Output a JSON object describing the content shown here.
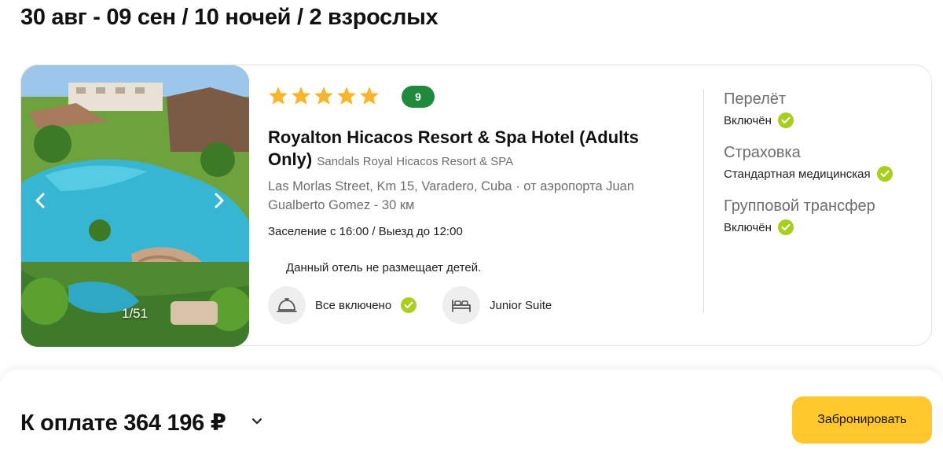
{
  "trip": {
    "summary": "30 авг - 09 сен / 10 ночей / 2 взрослых"
  },
  "hotel": {
    "stars": 5,
    "rating": "9",
    "name": "Royalton Hicacos Resort & Spa Hotel (Adults Only)",
    "alt_name": "Sandals Royal Hicacos Resort & SPA",
    "address": "Las Morlas Street, Km 15, Varadero, Cuba",
    "airport_distance": "от аэропорта Juan Gualberto Gomez - 30 км",
    "checkin_checkout": "Заселение с 16:00 / Выезд до 12:00",
    "children_note": "Данный отель не размещает детей.",
    "meal_plan": "Все включено",
    "room_type": "Junior Suite",
    "photo_counter": "1/51"
  },
  "services": [
    {
      "title": "Перелёт",
      "value": "Включён"
    },
    {
      "title": "Страховка",
      "value": "Стандартная медицинская"
    },
    {
      "title": "Групповой трансфер",
      "value": "Включён"
    }
  ],
  "footer": {
    "total_label": "К оплате 364 196 ₽",
    "book_label": "Забронировать"
  },
  "colors": {
    "accent": "#ffc72c",
    "rating_badge": "#1f8a3c",
    "check": "#a6cf1e",
    "star": "#f6b52b"
  },
  "icons": {
    "meal": "cloche-icon",
    "room": "bed-icon",
    "included": "check-circle-icon"
  }
}
